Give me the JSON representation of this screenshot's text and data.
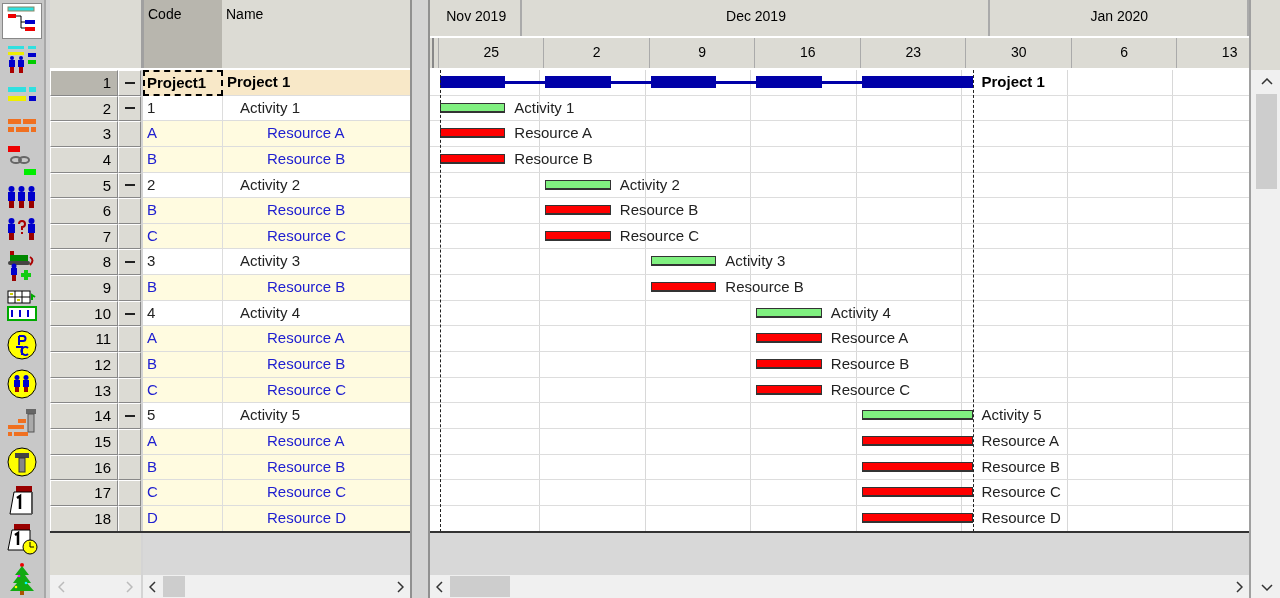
{
  "toolbar": [
    {
      "kind": "gantt",
      "selected": true
    },
    {
      "kind": "resource-bars",
      "selected": false
    },
    {
      "kind": "bars",
      "selected": false
    },
    {
      "kind": "bricks",
      "selected": false
    },
    {
      "kind": "chain",
      "selected": false
    },
    {
      "kind": "people",
      "selected": false
    },
    {
      "kind": "people-question",
      "selected": false
    },
    {
      "kind": "bulldozer",
      "selected": false
    },
    {
      "kind": "currency-table",
      "selected": false
    },
    {
      "kind": "currency-coin",
      "selected": false
    },
    {
      "kind": "people-coin",
      "selected": false
    },
    {
      "kind": "bricks-bolt",
      "selected": false
    },
    {
      "kind": "bolt-coin",
      "selected": false
    },
    {
      "kind": "calendar",
      "selected": false
    },
    {
      "kind": "calendar-clock",
      "selected": false
    },
    {
      "kind": "tree",
      "selected": false
    }
  ],
  "columns": [
    "Code",
    "Name"
  ],
  "timeline": {
    "months": [
      "Nov 2019",
      "Dec 2019",
      "Jan 2020"
    ],
    "weeks": [
      "25",
      "2",
      "9",
      "16",
      "23",
      "30",
      "6",
      "13"
    ]
  },
  "rows": [
    {
      "kind": "project",
      "num": "1",
      "code": "Project1",
      "name": "Project 1",
      "bar_label": "Project 1",
      "selected": true,
      "expanded": true,
      "children": [
        {
          "kind": "activity",
          "num": "2",
          "code": "1",
          "name": "Activity 1",
          "bar_label": "Activity 1",
          "selected": false,
          "expanded": true,
          "children": [
            {
              "kind": "resource",
              "num": "3",
              "code": "A",
              "name": "Resource A",
              "bar_label": "Resource A",
              "selected": false
            },
            {
              "kind": "resource",
              "num": "4",
              "code": "B",
              "name": "Resource B",
              "bar_label": "Resource B",
              "selected": false
            }
          ]
        },
        {
          "kind": "activity",
          "num": "5",
          "code": "2",
          "name": "Activity 2",
          "bar_label": "Activity 2",
          "selected": false,
          "expanded": true,
          "children": [
            {
              "kind": "resource",
              "num": "6",
              "code": "B",
              "name": "Resource B",
              "bar_label": "Resource B",
              "selected": false
            },
            {
              "kind": "resource",
              "num": "7",
              "code": "C",
              "name": "Resource C",
              "bar_label": "Resource C",
              "selected": false
            }
          ]
        },
        {
          "kind": "activity",
          "num": "8",
          "code": "3",
          "name": "Activity 3",
          "bar_label": "Activity 3",
          "selected": false,
          "expanded": true,
          "children": [
            {
              "kind": "resource",
              "num": "9",
              "code": "B",
              "name": "Resource B",
              "bar_label": "Resource B",
              "selected": false
            }
          ]
        },
        {
          "kind": "activity",
          "num": "10",
          "code": "4",
          "name": "Activity 4",
          "bar_label": "Activity 4",
          "selected": false,
          "expanded": true,
          "children": [
            {
              "kind": "resource",
              "num": "11",
              "code": "A",
              "name": "Resource A",
              "bar_label": "Resource A",
              "selected": false
            },
            {
              "kind": "resource",
              "num": "12",
              "code": "B",
              "name": "Resource B",
              "bar_label": "Resource B",
              "selected": false
            },
            {
              "kind": "resource",
              "num": "13",
              "code": "C",
              "name": "Resource C",
              "bar_label": "Resource C",
              "selected": false
            }
          ]
        },
        {
          "kind": "activity",
          "num": "14",
          "code": "5",
          "name": "Activity 5",
          "bar_label": "Activity 5",
          "selected": false,
          "expanded": true,
          "children": [
            {
              "kind": "resource",
              "num": "15",
              "code": "A",
              "name": "Resource A",
              "bar_label": "Resource A",
              "selected": false
            },
            {
              "kind": "resource",
              "num": "16",
              "code": "B",
              "name": "Resource B",
              "bar_label": "Resource B",
              "selected": false
            },
            {
              "kind": "resource",
              "num": "17",
              "code": "C",
              "name": "Resource C",
              "bar_label": "Resource C",
              "selected": false
            },
            {
              "kind": "resource",
              "num": "18",
              "code": "D",
              "name": "Resource D",
              "bar_label": "Resource D",
              "selected": false
            }
          ]
        }
      ]
    }
  ]
}
